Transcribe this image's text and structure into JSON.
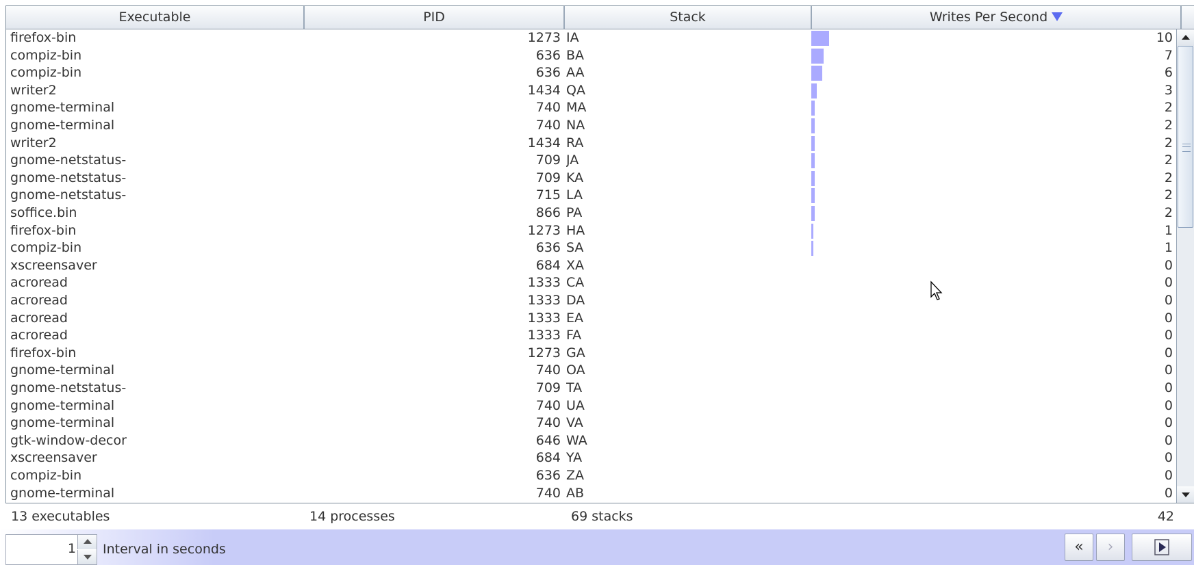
{
  "columns": [
    "Executable",
    "PID",
    "Stack",
    "Writes Per Second"
  ],
  "sort_icon": "sort-descending-icon",
  "bar_color": "#aaaaff",
  "bar_max": 10,
  "rows": [
    {
      "exe": "firefox-bin",
      "pid": "1273",
      "stack": "IA",
      "wps": "10"
    },
    {
      "exe": "compiz-bin",
      "pid": "636",
      "stack": "BA",
      "wps": "7"
    },
    {
      "exe": "compiz-bin",
      "pid": "636",
      "stack": "AA",
      "wps": "6"
    },
    {
      "exe": "writer2",
      "pid": "1434",
      "stack": "QA",
      "wps": "3"
    },
    {
      "exe": "gnome-terminal",
      "pid": "740",
      "stack": "MA",
      "wps": "2"
    },
    {
      "exe": "gnome-terminal",
      "pid": "740",
      "stack": "NA",
      "wps": "2"
    },
    {
      "exe": "writer2",
      "pid": "1434",
      "stack": "RA",
      "wps": "2"
    },
    {
      "exe": "gnome-netstatus-",
      "pid": "709",
      "stack": "JA",
      "wps": "2"
    },
    {
      "exe": "gnome-netstatus-",
      "pid": "709",
      "stack": "KA",
      "wps": "2"
    },
    {
      "exe": "gnome-netstatus-",
      "pid": "715",
      "stack": "LA",
      "wps": "2"
    },
    {
      "exe": "soffice.bin",
      "pid": "866",
      "stack": "PA",
      "wps": "2"
    },
    {
      "exe": "firefox-bin",
      "pid": "1273",
      "stack": "HA",
      "wps": "1"
    },
    {
      "exe": "compiz-bin",
      "pid": "636",
      "stack": "SA",
      "wps": "1"
    },
    {
      "exe": "xscreensaver",
      "pid": "684",
      "stack": "XA",
      "wps": "0"
    },
    {
      "exe": "acroread",
      "pid": "1333",
      "stack": "CA",
      "wps": "0"
    },
    {
      "exe": "acroread",
      "pid": "1333",
      "stack": "DA",
      "wps": "0"
    },
    {
      "exe": "acroread",
      "pid": "1333",
      "stack": "EA",
      "wps": "0"
    },
    {
      "exe": "acroread",
      "pid": "1333",
      "stack": "FA",
      "wps": "0"
    },
    {
      "exe": "firefox-bin",
      "pid": "1273",
      "stack": "GA",
      "wps": "0"
    },
    {
      "exe": "gnome-terminal",
      "pid": "740",
      "stack": "OA",
      "wps": "0"
    },
    {
      "exe": "gnome-netstatus-",
      "pid": "709",
      "stack": "TA",
      "wps": "0"
    },
    {
      "exe": "gnome-terminal",
      "pid": "740",
      "stack": "UA",
      "wps": "0"
    },
    {
      "exe": "gnome-terminal",
      "pid": "740",
      "stack": "VA",
      "wps": "0"
    },
    {
      "exe": "gtk-window-decor",
      "pid": "646",
      "stack": "WA",
      "wps": "0"
    },
    {
      "exe": "xscreensaver",
      "pid": "684",
      "stack": "YA",
      "wps": "0"
    },
    {
      "exe": "compiz-bin",
      "pid": "636",
      "stack": "ZA",
      "wps": "0"
    },
    {
      "exe": "gnome-terminal",
      "pid": "740",
      "stack": "AB",
      "wps": "0"
    }
  ],
  "footer": {
    "executables": "13 executables",
    "processes": "14 processes",
    "stacks": "69 stacks",
    "total": "42"
  },
  "toolbar": {
    "interval_value": "1",
    "interval_label": "Interval in seconds",
    "prev_icon": "double-chevron-left-icon",
    "next_icon": "chevron-right-icon",
    "play_icon": "play-icon"
  }
}
